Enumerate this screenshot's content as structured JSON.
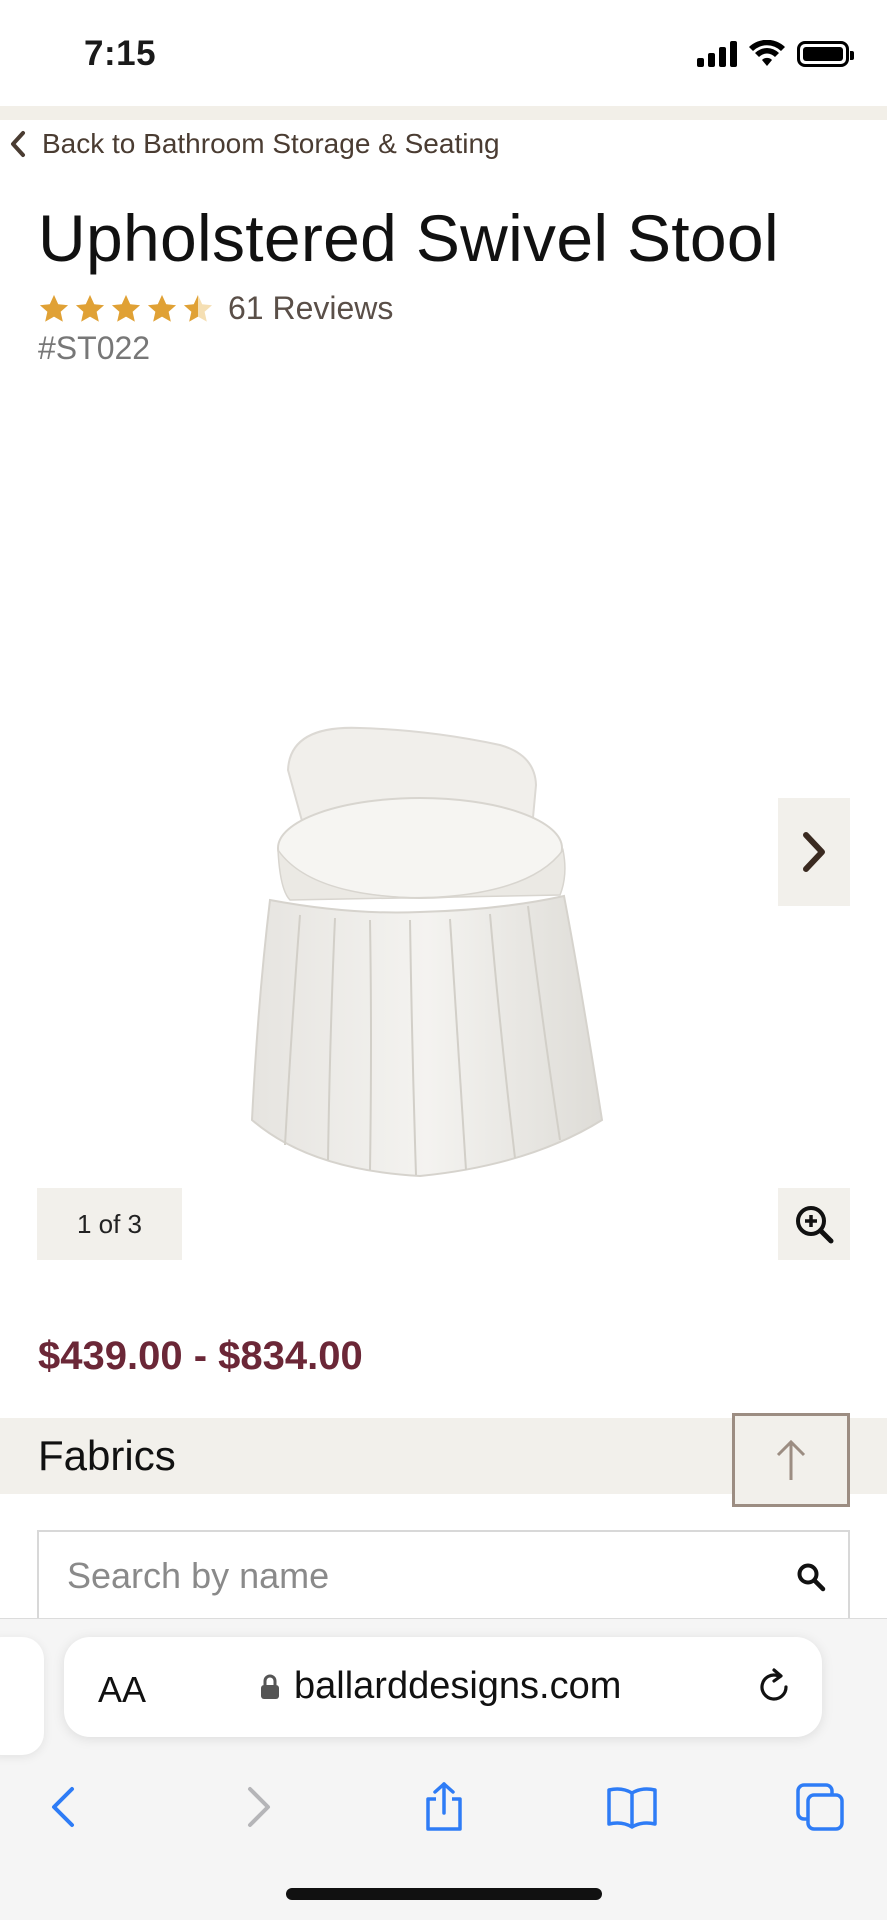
{
  "status_bar": {
    "time": "7:15"
  },
  "nav": {
    "back_label": "Back to Bathroom Storage & Seating"
  },
  "product": {
    "title": "Upholstered Swivel Stool",
    "rating": 4.5,
    "rating_max": 5,
    "reviews_label": "61 Reviews",
    "sku": "#ST022",
    "image_counter": "1 of 3",
    "price_range": "$439.00 - $834.00",
    "accent_color": "#6b2737",
    "star_color": "#e0a135"
  },
  "fabrics": {
    "label": "Fabrics",
    "search_placeholder": "Search by name"
  },
  "browser": {
    "text_size_label": "AA",
    "domain": "ballarddesigns.com"
  },
  "icons": {
    "back": "chevron-left-icon",
    "next": "chevron-right-icon",
    "zoom": "zoom-in-icon",
    "scroll_top": "arrow-up-icon",
    "search": "search-icon",
    "lock": "lock-icon",
    "reload": "reload-icon",
    "toolbar": [
      "back-arrow-icon",
      "forward-arrow-icon",
      "share-icon",
      "bookmarks-icon",
      "tabs-icon"
    ]
  }
}
